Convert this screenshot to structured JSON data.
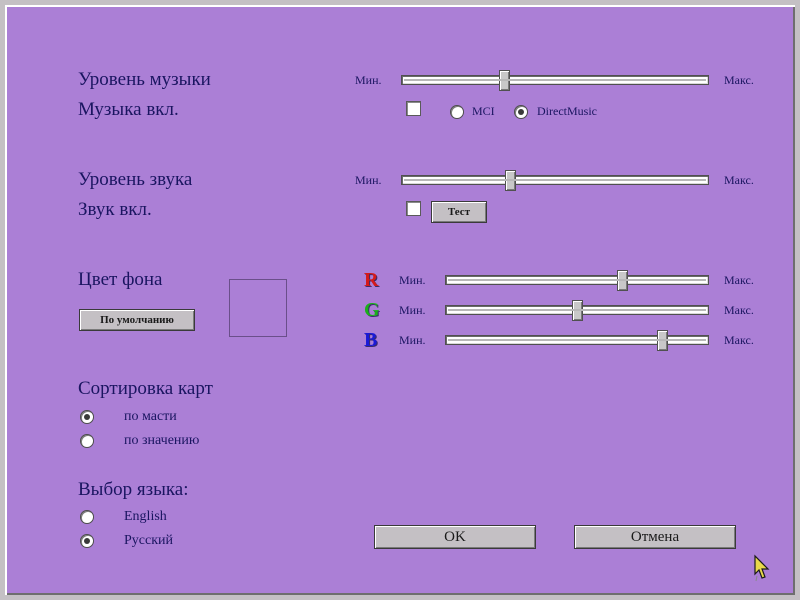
{
  "music": {
    "level_label": "Уровень музыки",
    "enabled_label": "Музыка вкл.",
    "min_label": "Мин.",
    "max_label": "Макс.",
    "level": 0.33,
    "enabled": false,
    "options": [
      {
        "label": "MCI",
        "selected": false
      },
      {
        "label": "DirectMusic",
        "selected": true
      }
    ]
  },
  "sound": {
    "level_label": "Уровень звука",
    "enabled_label": "Звук вкл.",
    "min_label": "Мин.",
    "max_label": "Макс.",
    "level": 0.35,
    "enabled": false,
    "test_label": "Тест"
  },
  "background": {
    "label": "Цвет фона",
    "default_label": "По умолчанию",
    "swatch_color": "#ab7fd6",
    "channels": [
      {
        "letter": "R",
        "color": "#d41a1a",
        "min_label": "Мин.",
        "max_label": "Макс.",
        "level": 0.68
      },
      {
        "letter": "G",
        "color": "#1ab01a",
        "min_label": "Мин.",
        "max_label": "Макс.",
        "level": 0.5
      },
      {
        "letter": "B",
        "color": "#1a1ad6",
        "min_label": "Мин.",
        "max_label": "Макс.",
        "level": 0.84
      }
    ]
  },
  "sort": {
    "label": "Сортировка карт",
    "options": [
      {
        "label": "по масти",
        "selected": true
      },
      {
        "label": "по значению",
        "selected": false
      }
    ]
  },
  "language": {
    "label": "Выбор языка:",
    "options": [
      {
        "label": "English",
        "selected": false
      },
      {
        "label": "Русский",
        "selected": true
      }
    ]
  },
  "buttons": {
    "ok_label": "OK",
    "cancel_label": "Отмена"
  }
}
